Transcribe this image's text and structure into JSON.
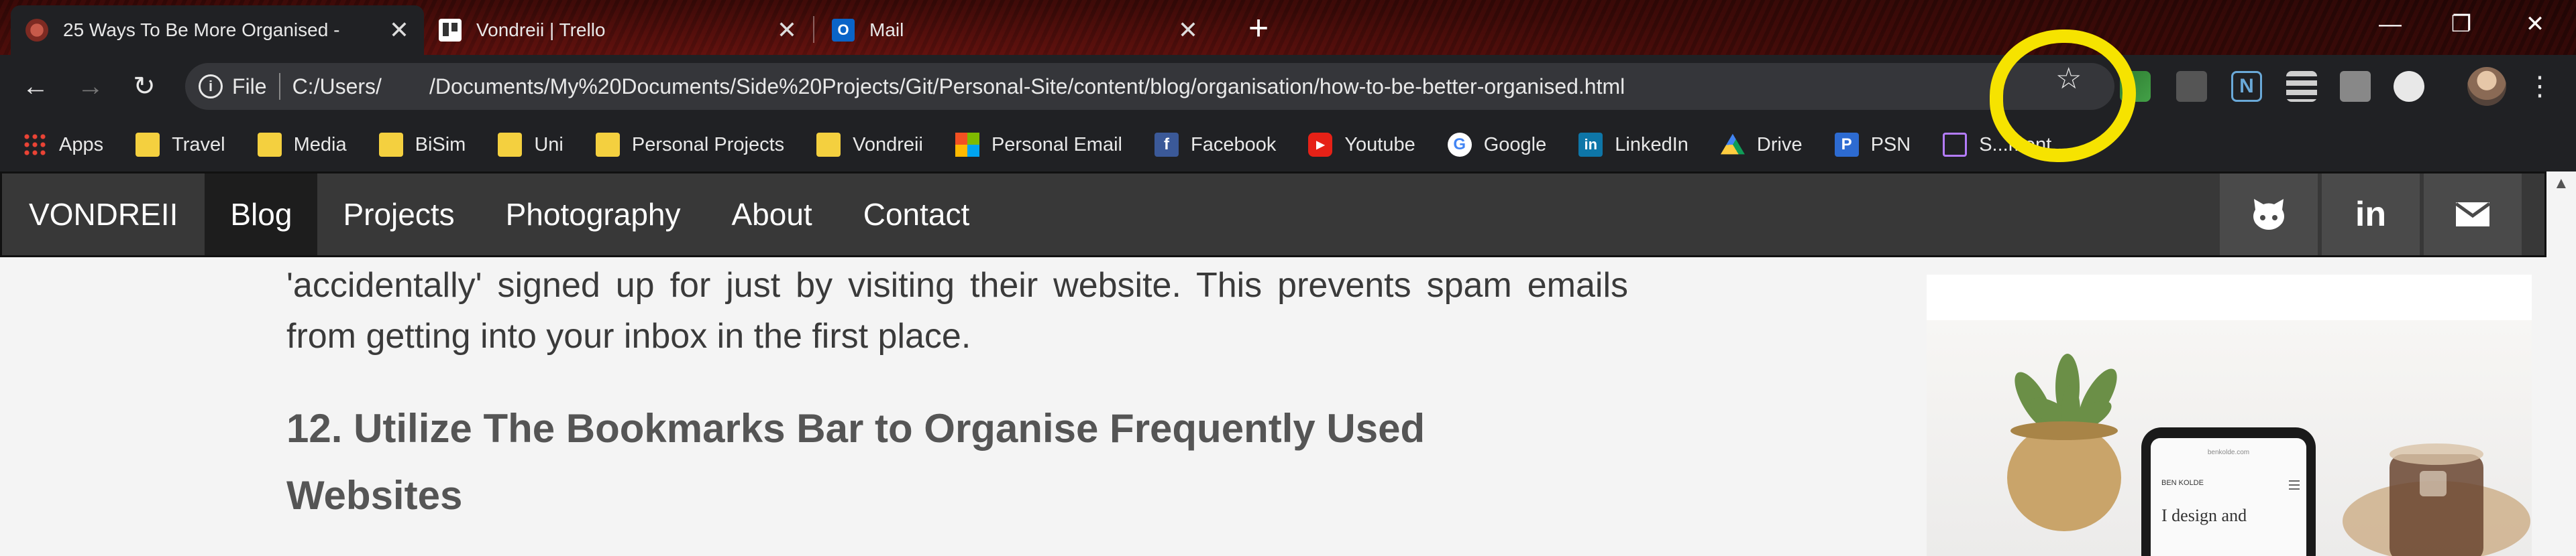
{
  "browser": {
    "tabs": [
      {
        "title": "25 Ways To Be More Organised -",
        "active": true
      },
      {
        "title": "Vondreii | Trello",
        "active": false
      },
      {
        "title": "Mail",
        "active": false
      }
    ],
    "address": {
      "scheme_label": "File",
      "url": "C:/Users/        /Documents/My%20Documents/Side%20Projects/Git/Personal-Site/content/blog/organisation/how-to-be-better-organised.html"
    },
    "bookmarks": [
      {
        "label": "Apps",
        "icon": "apps-grid-icon"
      },
      {
        "label": "Travel",
        "icon": "folder-icon"
      },
      {
        "label": "Media",
        "icon": "folder-icon"
      },
      {
        "label": "BiSim",
        "icon": "folder-icon"
      },
      {
        "label": "Uni",
        "icon": "folder-icon"
      },
      {
        "label": "Personal Projects",
        "icon": "folder-icon"
      },
      {
        "label": "Vondreii",
        "icon": "folder-icon"
      },
      {
        "label": "Personal Email",
        "icon": "microsoft-icon"
      },
      {
        "label": "Facebook",
        "icon": "facebook-icon"
      },
      {
        "label": "Youtube",
        "icon": "youtube-icon"
      },
      {
        "label": "Google",
        "icon": "google-icon"
      },
      {
        "label": "LinkedIn",
        "icon": "linkedin-icon"
      },
      {
        "label": "Drive",
        "icon": "drive-icon"
      },
      {
        "label": "PSN",
        "icon": "psn-icon"
      },
      {
        "label": "S...ment...",
        "icon": "bookmark-icon"
      }
    ]
  },
  "site": {
    "brand": "VONDREII",
    "nav": [
      "Blog",
      "Projects",
      "Photography",
      "About",
      "Contact"
    ],
    "active_nav": "Blog",
    "social_icons": [
      "github-icon",
      "linkedin-icon",
      "email-icon"
    ]
  },
  "article": {
    "paragraph": "'accidentally' signed up for just by visiting their website. This prevents spam emails from getting into your inbox in the first place.",
    "heading": "12. Utilize The Bookmarks Bar to Organise Frequently Used Websites"
  },
  "sidebar": {
    "image_site": "benkolde.com",
    "image_name": "BEN KOLDE",
    "image_text": "I design and"
  },
  "colors": {
    "annotation": "#f6e300",
    "nav_bg": "#383838",
    "page_bg": "#f4f4f4"
  }
}
